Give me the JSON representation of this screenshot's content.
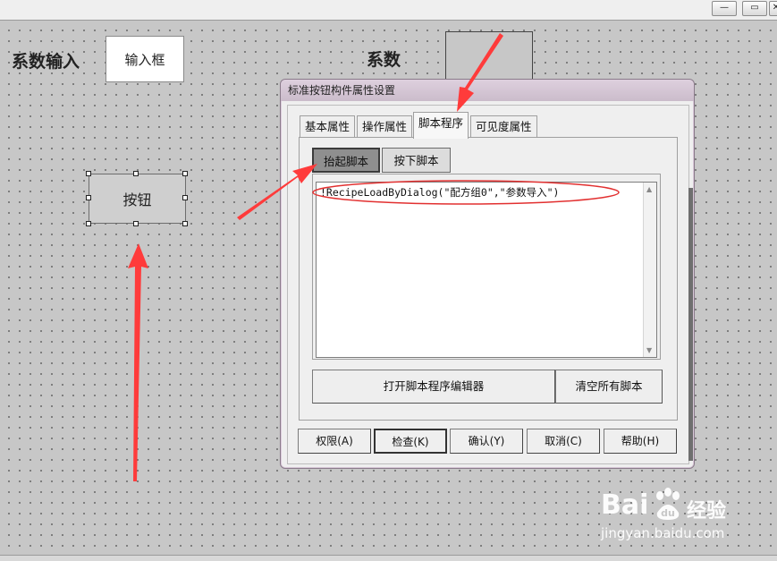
{
  "window": {
    "controls": [
      "—",
      "▭",
      "✕"
    ]
  },
  "canvas": {
    "coef_input_label": "系数输入",
    "input_box_text": "输入框",
    "coef_label": "系数",
    "button_text": "按钮"
  },
  "dialog": {
    "title": "标准按钮构件属性设置",
    "tabs": [
      {
        "label": "基本属性",
        "active": false
      },
      {
        "label": "操作属性",
        "active": false
      },
      {
        "label": "脚本程序",
        "active": true
      },
      {
        "label": "可见度属性",
        "active": false
      }
    ],
    "subtabs": [
      {
        "label": "抬起脚本",
        "active": true
      },
      {
        "label": "按下脚本",
        "active": false
      }
    ],
    "script_text": "!RecipeLoadByDialog(\"配方组0\",\"参数导入\")",
    "open_editor_label": "打开脚本程序编辑器",
    "clear_scripts_label": "清空所有脚本",
    "footer_buttons": [
      {
        "label": "权限(A)"
      },
      {
        "label": "检查(K)"
      },
      {
        "label": "确认(Y)"
      },
      {
        "label": "取消(C)"
      },
      {
        "label": "帮助(H)"
      }
    ]
  },
  "annotations": {
    "arrow_color": "#ff3b3b",
    "highlight_ellipse_color": "#e23030"
  },
  "watermark": {
    "brand": "Bai",
    "brand_paw": "du",
    "sub": "经验",
    "url": "jingyan.baidu.com"
  }
}
